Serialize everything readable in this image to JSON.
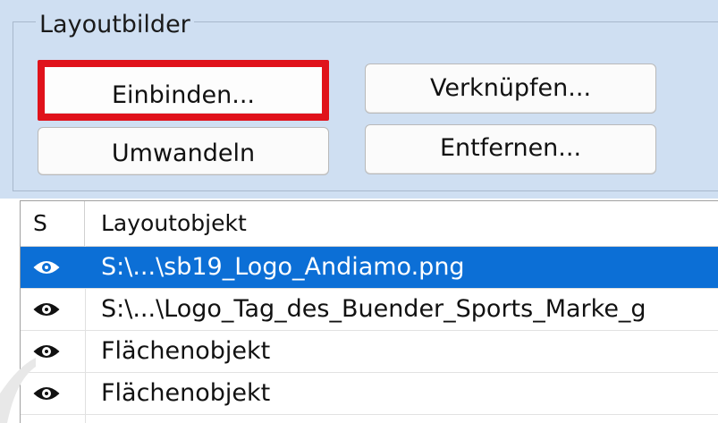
{
  "group": {
    "title": "Layoutbilder"
  },
  "buttons": {
    "einbinden": "Einbinden...",
    "verknuepfen": "Verknüpfen...",
    "umwandeln": "Umwandeln",
    "entfernen": "Entfernen..."
  },
  "list": {
    "columns": [
      "S",
      "Layoutobjekt"
    ],
    "rows": [
      {
        "icon": "eye-icon",
        "text": "S:\\...\\sb19_Logo_Andiamo.png",
        "selected": true
      },
      {
        "icon": "eye-icon",
        "text": "S:\\...\\Logo_Tag_des_Buender_Sports_Marke_g",
        "selected": false
      },
      {
        "icon": "eye-icon",
        "text": "Flächenobjekt",
        "selected": false
      },
      {
        "icon": "eye-icon",
        "text": "Flächenobjekt",
        "selected": false
      }
    ]
  },
  "colors": {
    "panel_bg": "#cfdff2",
    "highlight_border": "#e0121b",
    "selection": "#0c6fd6"
  }
}
